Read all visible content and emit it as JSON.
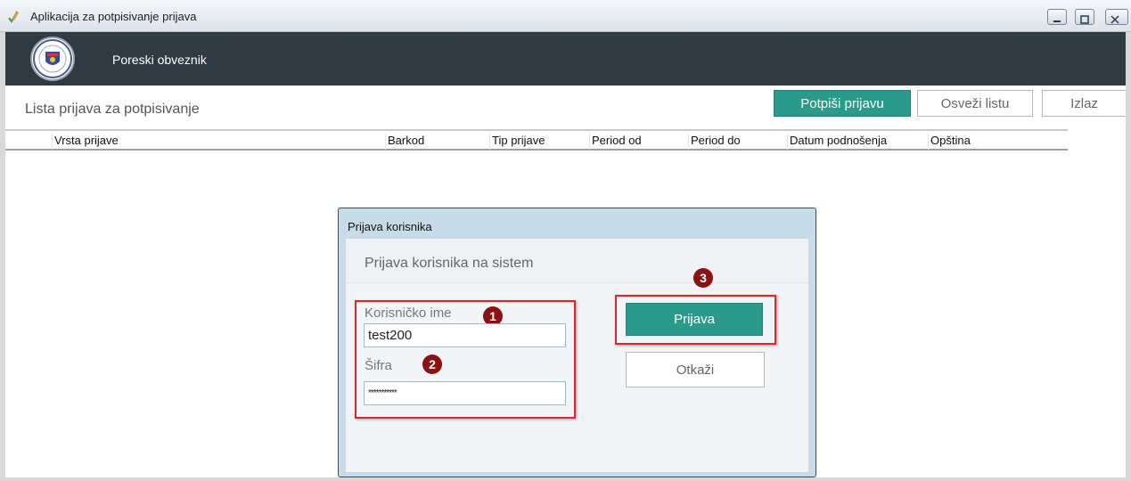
{
  "window": {
    "title": "Aplikacija za potpisivanje prijava"
  },
  "header": {
    "user_role": "Poreski obveznik"
  },
  "toolbar": {
    "list_title": "Lista prijava za potpisivanje",
    "sign_label": "Potpiši prijavu",
    "refresh_label": "Osveži listu",
    "exit_label": "Izlaz"
  },
  "table": {
    "columns": [
      "Vrsta prijave",
      "Barkod",
      "Tip prijave",
      "Period od",
      "Period do",
      "Datum podnošenja",
      "Opština"
    ]
  },
  "dialog": {
    "title": "Prijava korisnika",
    "subtitle": "Prijava korisnika na sistem",
    "username_label": "Korisničko ime",
    "username_value": "test200",
    "password_label": "Šifra",
    "password_value": "***********",
    "login_label": "Prijava",
    "cancel_label": "Otkaži"
  },
  "markers": {
    "m1": "1",
    "m2": "2",
    "m3": "3"
  },
  "colors": {
    "header_bg": "#2f3a42",
    "primary": "#2a9a8b",
    "highlight": "#e0242b",
    "marker": "#8a1212"
  },
  "icons": {
    "app": "pen-check-icon",
    "logo": "coat-of-arms-icon",
    "minimize": "minimize-icon",
    "maximize": "maximize-icon",
    "close": "close-icon"
  }
}
